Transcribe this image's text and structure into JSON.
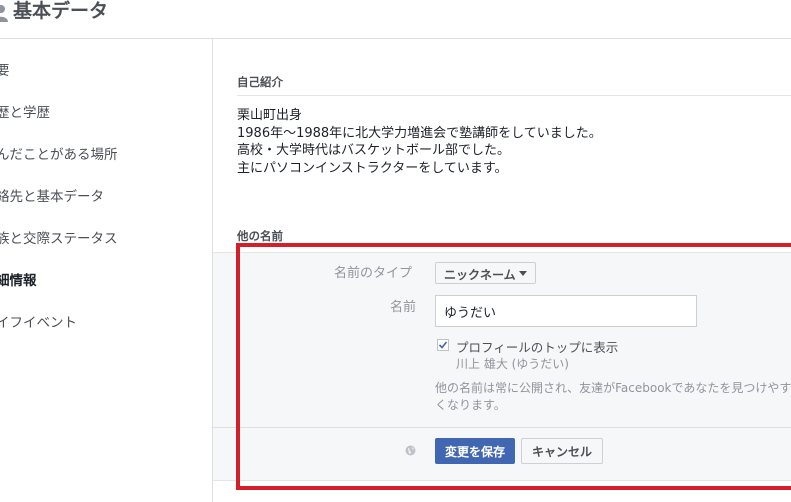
{
  "header": {
    "title": "基本データ"
  },
  "nav": {
    "items": [
      {
        "label": "要"
      },
      {
        "label": "歴と学歴"
      },
      {
        "label": "んだことがある場所"
      },
      {
        "label": "絡先と基本データ"
      },
      {
        "label": "族と交際ステータス"
      },
      {
        "label": "細情報",
        "active": true
      },
      {
        "label": "イフイベント"
      }
    ]
  },
  "bio_section": {
    "title": "自己紹介",
    "lines": [
      "栗山町出身",
      "1986年〜1988年に北大学力増進会で塾講師をしていました。",
      "高校・大学時代はバスケットボール部でした。",
      "主にパソコンインストラクターをしています。"
    ]
  },
  "other_names": {
    "title": "他の名前",
    "name_type_label": "名前のタイプ",
    "name_type_value": "ニックネーム",
    "name_label": "名前",
    "name_value": "ゆうだい",
    "show_on_top_label": "プロフィールのトップに表示",
    "show_on_top_checked": true,
    "preview_name": "川上 雄大 (ゆうだい)",
    "note_lines": [
      "他の名前は常に公開され、友達がFacebookであなたを見つけやす",
      "くなります。"
    ],
    "save_label": "変更を保存",
    "cancel_label": "キャンセル"
  },
  "colors": {
    "primary_button": "#4267b2",
    "highlight_border": "#d21f2a"
  }
}
